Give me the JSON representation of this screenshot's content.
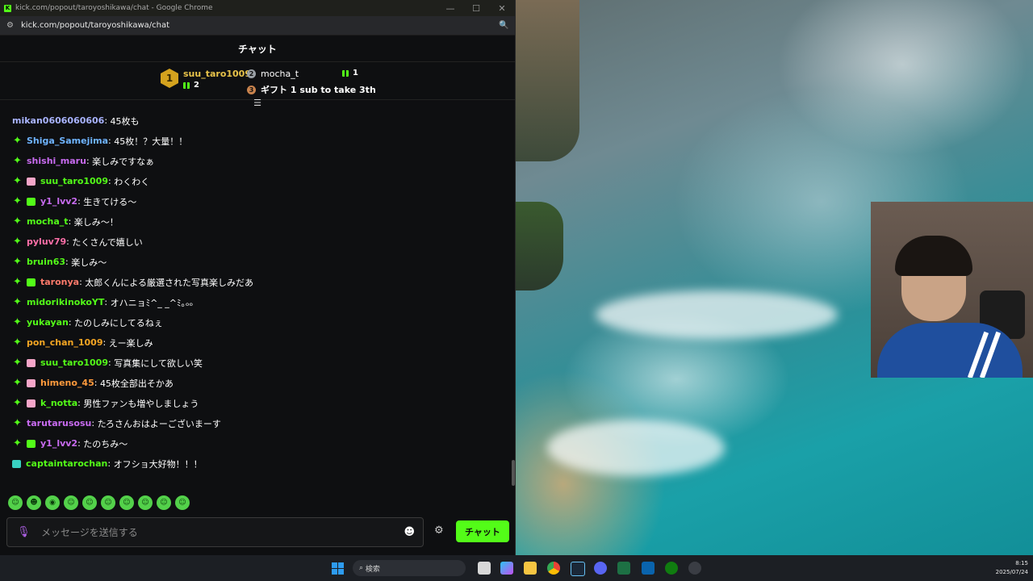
{
  "window": {
    "title": "kick.com/popout/taroyoshikawa/chat - Google Chrome",
    "url": "kick.com/popout/taroyoshikawa/chat",
    "controls": {
      "minimize": "—",
      "maximize": "☐",
      "close": "✕"
    }
  },
  "chat": {
    "header": "チャット",
    "leaderboard": {
      "first": {
        "rank": "1",
        "name": "suu_taro1009",
        "count": "2"
      },
      "second": {
        "rank": "2",
        "name": "mocha_t",
        "count": "1"
      },
      "third": {
        "rank": "3",
        "text": "ギフト 1 sub to take 3th"
      }
    },
    "messages": [
      {
        "user": "mikan0606060606",
        "text": "45枚も",
        "color": "#a9b4ff",
        "star": false,
        "badge": ""
      },
      {
        "user": "Shiga_Samejima",
        "text": "45枚！？大量！！",
        "color": "#6fb4ff",
        "star": true,
        "badge": ""
      },
      {
        "user": "shishi_maru",
        "text": "楽しみですなぁ",
        "color": "#c86bf0",
        "star": true,
        "badge": ""
      },
      {
        "user": "suu_taro1009",
        "text": "わくわく",
        "color": "#53fc18",
        "star": true,
        "badge": "pink"
      },
      {
        "user": "y1_lvv2",
        "text": "生きてける〜",
        "color": "#c86bf0",
        "star": true,
        "badge": "gift"
      },
      {
        "user": "mocha_t",
        "text": "楽しみ〜！",
        "color": "#53fc18",
        "star": true,
        "badge": ""
      },
      {
        "user": "pyluv79",
        "text": "たくさんで嬉しい",
        "color": "#ff6fa8",
        "star": true,
        "badge": ""
      },
      {
        "user": "bruin63",
        "text": "楽しみ〜",
        "color": "#53fc18",
        "star": true,
        "badge": ""
      },
      {
        "user": "taronya",
        "text": "太郎くんによる厳選された写真楽しみだあ",
        "color": "#ff7a6b",
        "star": true,
        "badge": "gift"
      },
      {
        "user": "midorikinokoYT",
        "text": "オハニョﾐ^_ _^ﾐ｡ₒₒ",
        "color": "#53fc18",
        "star": true,
        "badge": ""
      },
      {
        "user": "yukayan",
        "text": "たのしみにしてるねぇ",
        "color": "#53fc18",
        "star": true,
        "badge": ""
      },
      {
        "user": "pon_chan_1009",
        "text": "えー楽しみ",
        "color": "#f5a623",
        "star": true,
        "badge": ""
      },
      {
        "user": "suu_taro1009",
        "text": "写真集にして欲しい笑",
        "color": "#53fc18",
        "star": true,
        "badge": "pink"
      },
      {
        "user": "himeno_45",
        "text": "45枚全部出そかあ",
        "color": "#ff9a3c",
        "star": true,
        "badge": "pink"
      },
      {
        "user": "k_notta",
        "text": "男性ファンも増やしましょう",
        "color": "#53fc18",
        "star": true,
        "badge": "pink"
      },
      {
        "user": "tarutarusosu",
        "text": "たろさんおはよーございまーす",
        "color": "#c86bf0",
        "star": true,
        "badge": ""
      },
      {
        "user": "y1_lvv2",
        "text": "たのちみ〜",
        "color": "#c86bf0",
        "star": true,
        "badge": "gift"
      },
      {
        "user": "captaintarochan",
        "text": "オフショ大好物！！！",
        "color": "#53fc18",
        "star": false,
        "badge": "teal"
      }
    ],
    "emotes": [
      "☺",
      "☻",
      "◉",
      "☺",
      "☺",
      "☺",
      "☺",
      "☺",
      "☺",
      "☺"
    ],
    "input_placeholder": "メッセージを送信する",
    "send_label": "チャット"
  },
  "taskbar": {
    "search_label": "検索",
    "time": "8:15",
    "date": "2025/07/24"
  }
}
